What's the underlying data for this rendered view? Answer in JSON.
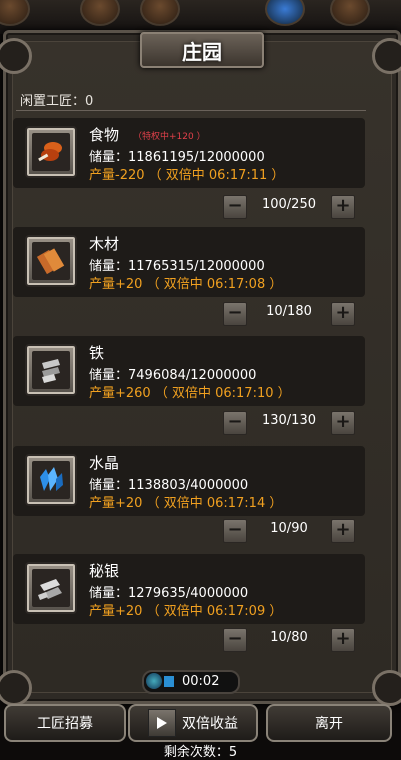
{
  "title": "庄园",
  "idle_label": "闲置工匠：0",
  "resources": [
    {
      "name": "食物",
      "badge": "（特权中+120 ）",
      "storage": "储量：11861195/12000000",
      "production": "产量-220 （ 双倍中 06:17:11 ）",
      "count": "100/250",
      "icon": "food-meat-icon"
    },
    {
      "name": "木材",
      "badge": "",
      "storage": "储量：11765315/12000000",
      "production": "产量+20 （ 双倍中 06:17:08 ）",
      "count": "10/180",
      "icon": "wood-planks-icon"
    },
    {
      "name": "铁",
      "badge": "",
      "storage": "储量：7496084/12000000",
      "production": "产量+260 （ 双倍中 06:17:10 ）",
      "count": "130/130",
      "icon": "iron-ingot-icon"
    },
    {
      "name": "水晶",
      "badge": "",
      "storage": "储量：1138803/4000000",
      "production": "产量+20 （ 双倍中 06:17:14 ）",
      "count": "10/90",
      "icon": "crystal-icon"
    },
    {
      "name": "秘银",
      "badge": "",
      "storage": "储量：1279635/4000000",
      "production": "产量+20 （ 双倍中 06:17:09 ）",
      "count": "10/80",
      "icon": "mithril-icon"
    }
  ],
  "timer": "00:02",
  "buttons": {
    "recruit": "工匠招募",
    "double": "双倍收益",
    "leave": "离开"
  },
  "remaining": "剩余次数：5",
  "colors": {
    "production": "#f0a020",
    "badge": "#e0404a"
  }
}
